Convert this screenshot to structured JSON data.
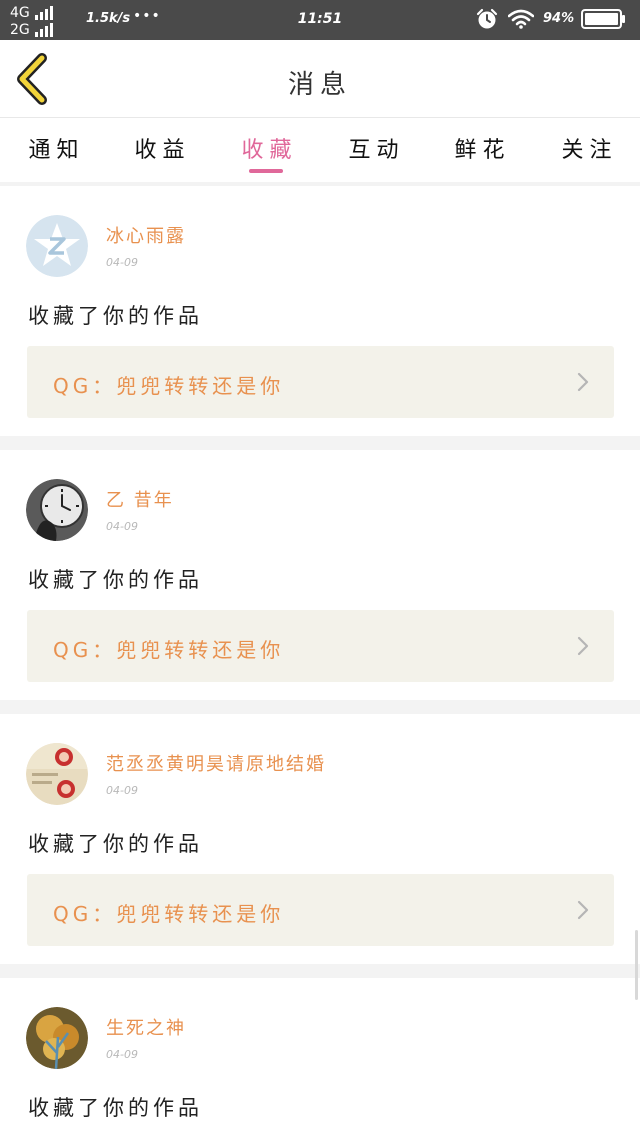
{
  "status_bar": {
    "network_top": "4G",
    "network_bottom": "2G",
    "speed": "1.5k/s",
    "dots": "•••",
    "time": "11:51",
    "battery_percent": "94%",
    "icons": [
      "signal-icon",
      "alarm-icon",
      "wifi-icon",
      "battery-icon"
    ]
  },
  "header": {
    "title": "消息",
    "back_icon": "chevron-left-icon"
  },
  "tabs": [
    {
      "label": "通知",
      "active": false
    },
    {
      "label": "收益",
      "active": false
    },
    {
      "label": "收藏",
      "active": true
    },
    {
      "label": "互动",
      "active": false
    },
    {
      "label": "鲜花",
      "active": false
    },
    {
      "label": "关注",
      "active": false
    }
  ],
  "notifications": [
    {
      "username": "冰心雨露",
      "date": "04-09",
      "action": "收藏了你的作品",
      "work": "QG：兜兜转转还是你"
    },
    {
      "username": "乙  昔年",
      "date": "04-09",
      "action": "收藏了你的作品",
      "work": "QG：兜兜转转还是你"
    },
    {
      "username": "范丞丞黄明昊请原地结婚",
      "date": "04-09",
      "action": "收藏了你的作品",
      "work": "QG：兜兜转转还是你"
    },
    {
      "username": "生死之神",
      "date": "04-09",
      "action": "收藏了你的作品",
      "work": ""
    }
  ],
  "colors": {
    "accent_pink": "#e0689a",
    "username_orange": "#e8914f",
    "back_yellow": "#f2d43a",
    "work_row_bg": "#f3f2ea",
    "status_bar_bg": "#4a4a4a"
  }
}
